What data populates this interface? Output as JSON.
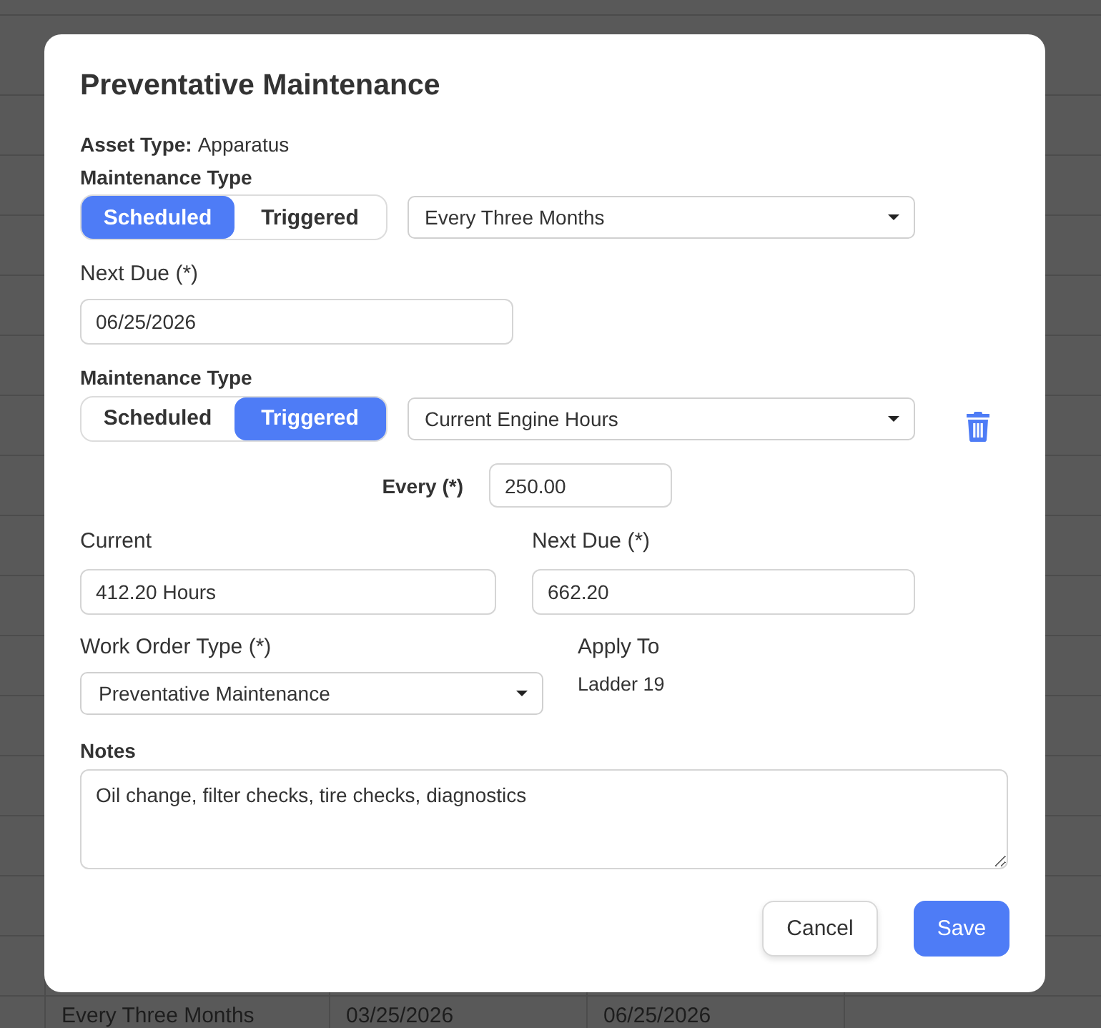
{
  "background_table": {
    "rows": [
      {
        "cells": [
          "Every Three Months",
          "03/25/2026",
          "06/25/2026"
        ]
      }
    ]
  },
  "dialog": {
    "title": "Preventative Maintenance",
    "asset_type": {
      "label": "Asset Type:",
      "value": "Apparatus"
    },
    "schedules": [
      {
        "kind": "scheduled",
        "label": "Maintenance Type",
        "options": [
          {
            "label": "Scheduled",
            "selected": true
          },
          {
            "label": "Triggered",
            "selected": false
          }
        ],
        "interval": "Every Three Months",
        "removable": false,
        "next_due": {
          "label": "Next Due (*)",
          "value": "06/25/2026"
        }
      },
      {
        "kind": "triggered",
        "label": "Maintenance Type",
        "options": [
          {
            "label": "Scheduled",
            "selected": false
          },
          {
            "label": "Triggered",
            "selected": true
          }
        ],
        "interval": "Current Engine Hours",
        "removable": true,
        "every": {
          "label": "Every (*)",
          "value": "250.00"
        },
        "current": {
          "label": "Current",
          "value": "412.20 Hours"
        },
        "next_due": {
          "label": "Next Due (*)",
          "value": "662.20"
        }
      }
    ],
    "work_order_type": {
      "label": "Work Order Type (*)",
      "value": "Preventative Maintenance"
    },
    "apply_to": {
      "label": "Apply To",
      "value": "Ladder 19"
    },
    "notes": {
      "label": "Notes",
      "value": "Oil change, filter checks, tire checks, diagnostics"
    },
    "buttons": [
      {
        "kind": "secondary",
        "label": "Cancel"
      },
      {
        "kind": "primary",
        "label": "Save"
      }
    ]
  }
}
